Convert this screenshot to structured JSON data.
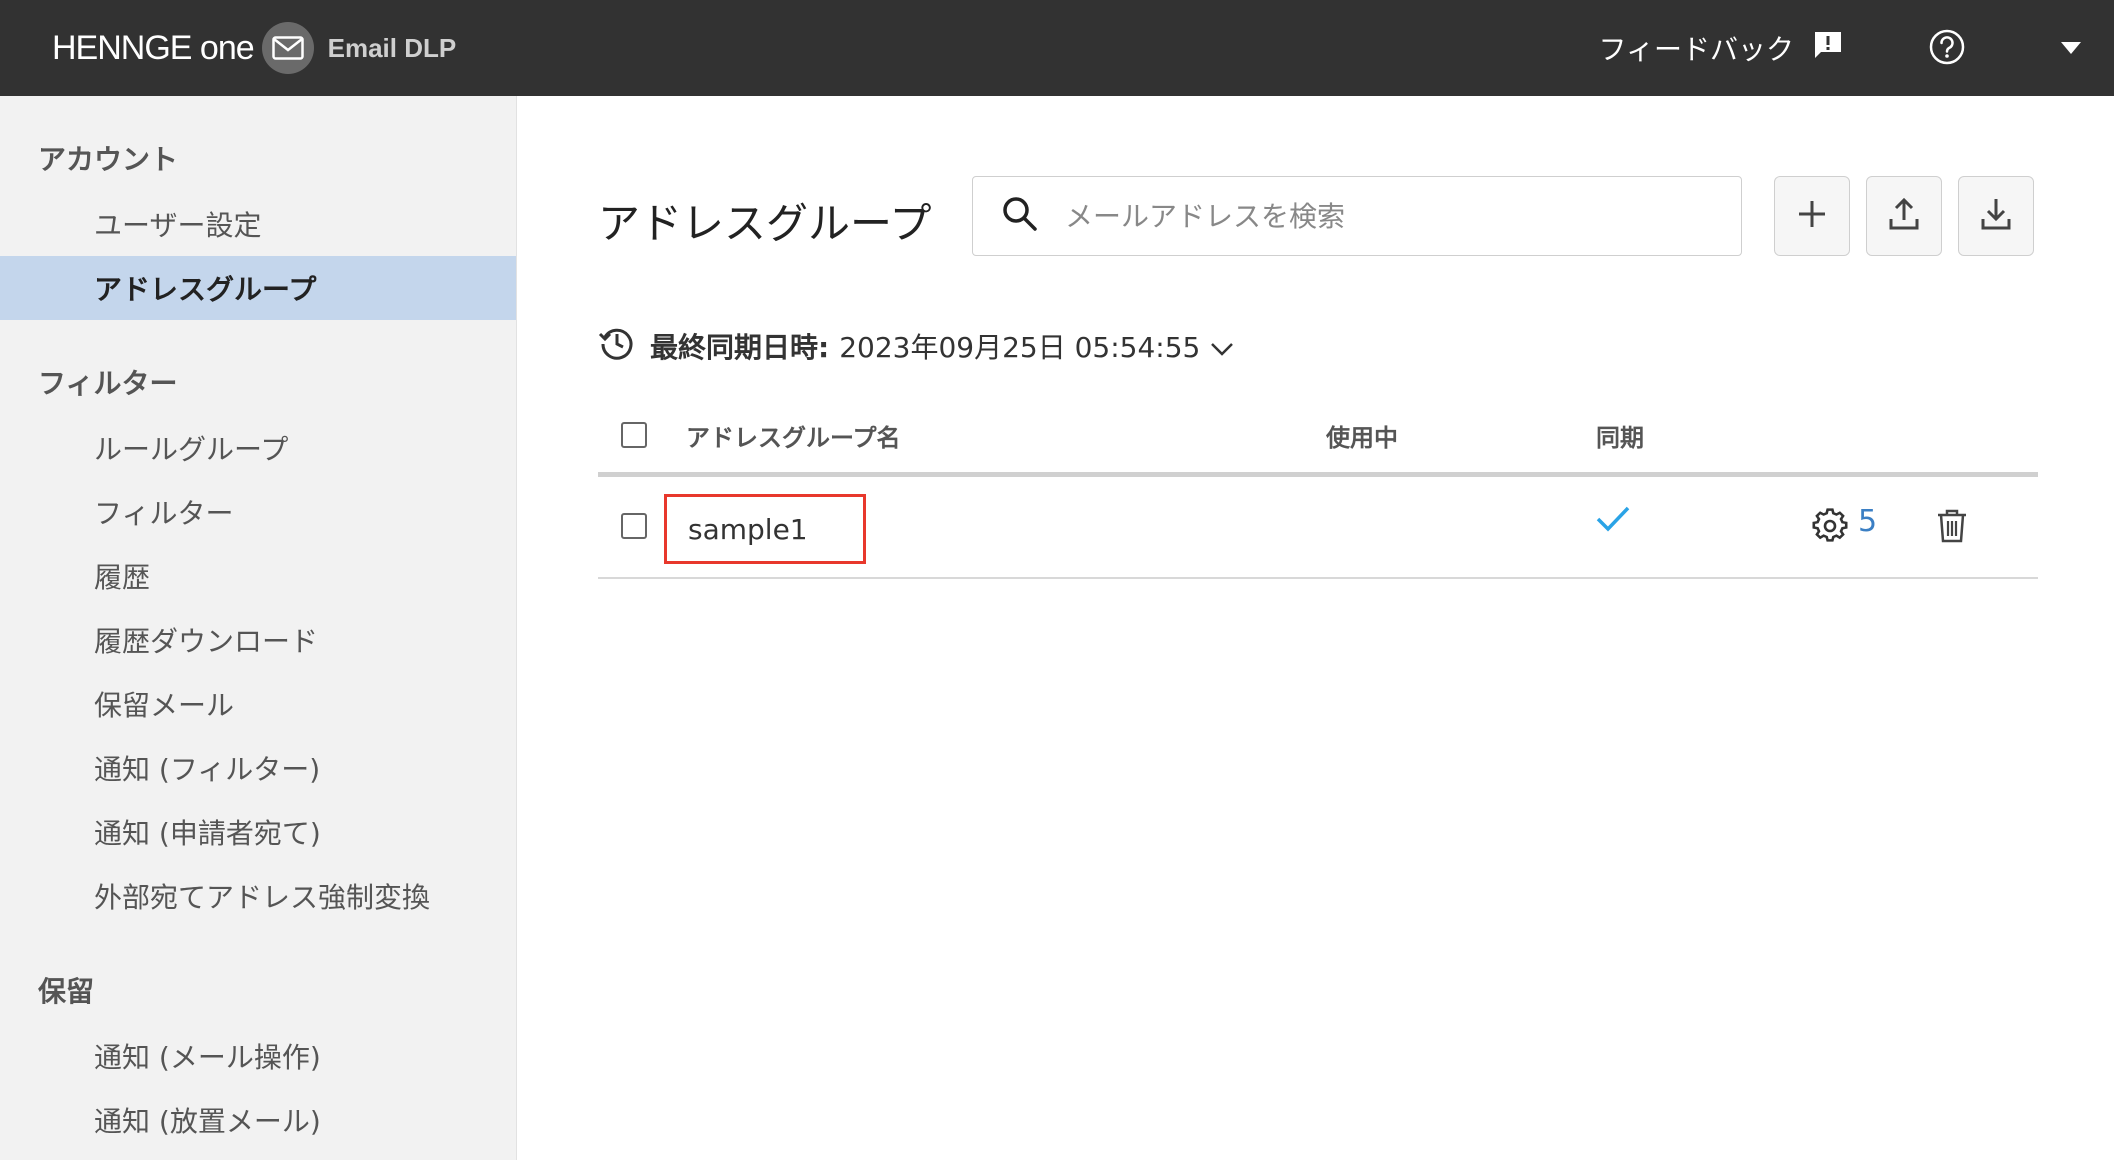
{
  "header": {
    "brand_name": "HENNGE one",
    "product_name": "Email DLP",
    "feedback_label": "フィードバック",
    "icons": [
      "mail-logo-icon",
      "feedback-icon",
      "help-icon",
      "caret-down-icon"
    ]
  },
  "sidebar": {
    "sections": [
      {
        "title": "アカウント",
        "items": [
          "ユーザー設定",
          "アドレスグループ"
        ]
      },
      {
        "title": "フィルター",
        "items": [
          "ルールグループ",
          "フィルター",
          "履歴",
          "履歴ダウンロード",
          "保留メール",
          "通知 (フィルター)",
          "通知 (申請者宛て)",
          "外部宛てアドレス強制変換"
        ]
      },
      {
        "title": "保留",
        "items": [
          "通知 (メール操作)",
          "通知 (放置メール)"
        ]
      }
    ],
    "active_item": "アドレスグループ"
  },
  "main": {
    "title": "アドレスグループ",
    "search": {
      "placeholder": "メールアドレスを検索",
      "value": ""
    },
    "toolbar": {
      "buttons": [
        "add-icon",
        "upload-icon",
        "download-icon"
      ]
    },
    "sync": {
      "label": "最終同期日時:",
      "value": "2023年09月25日 05:54:55"
    },
    "table": {
      "columns": [
        "アドレスグループ名",
        "使用中",
        "同期"
      ],
      "rows": [
        {
          "name": "sample1",
          "in_use": "",
          "synced": true,
          "settings_count": "5"
        }
      ]
    }
  },
  "colors": {
    "header_bg": "#323232",
    "sidebar_bg": "#f2f2f2",
    "active_bg": "#c4d6ec",
    "accent": "#3b7fc4",
    "check": "#2aa3e6",
    "highlight": "#e8382c"
  }
}
